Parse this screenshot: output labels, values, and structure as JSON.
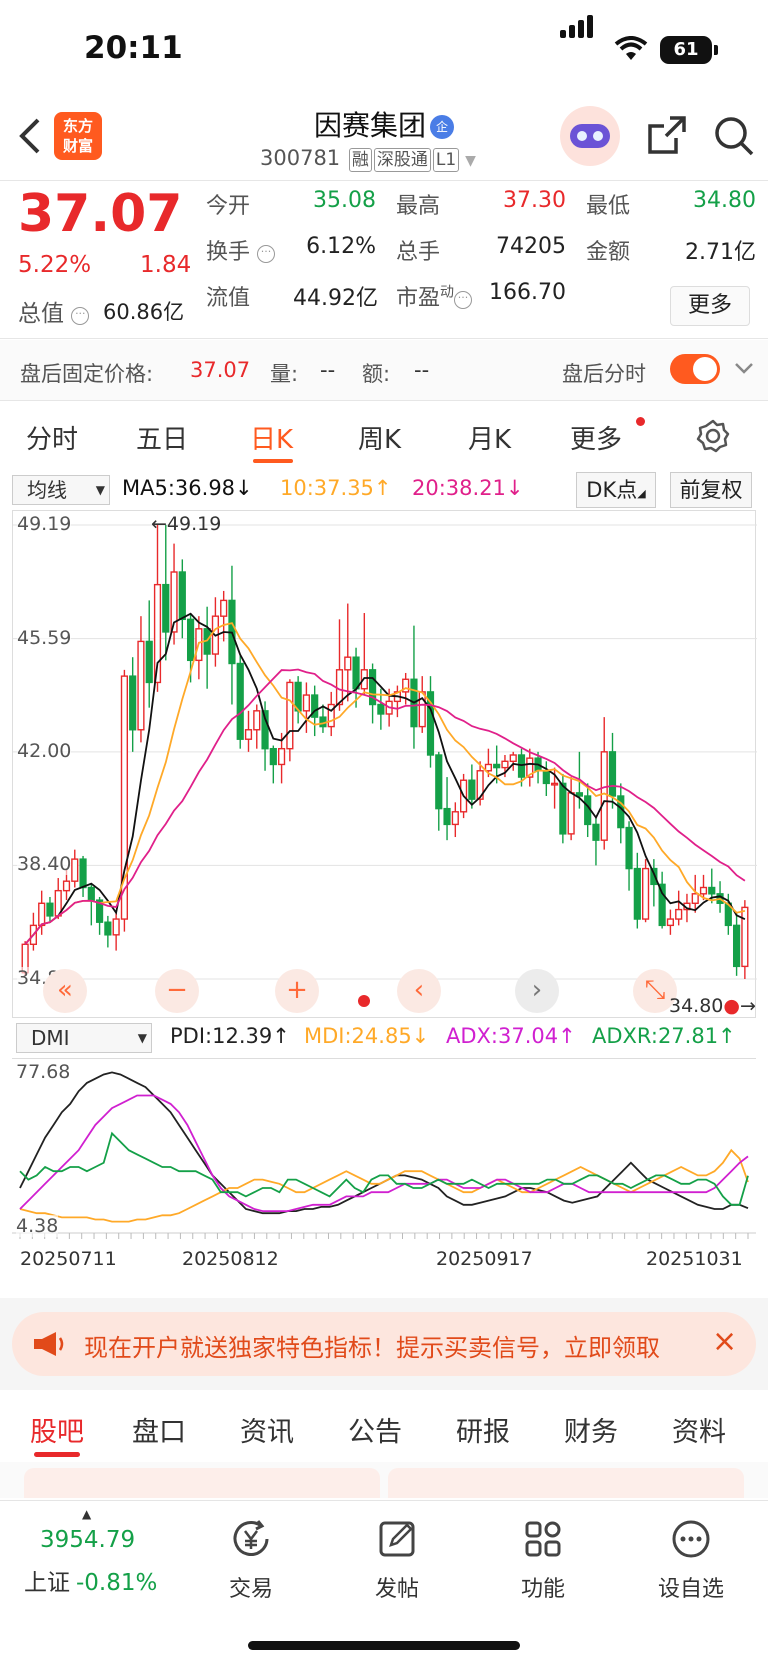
{
  "status": {
    "time": "20:11",
    "battery": "61"
  },
  "header": {
    "logo": [
      "东方",
      "财富"
    ],
    "name": "因赛集团",
    "name_badge": "企",
    "code": "300781",
    "tags": [
      "融",
      "深股通",
      "L1"
    ]
  },
  "quote": {
    "price": "37.07",
    "pct": "5.22%",
    "change": "1.84",
    "total_value_label": "总值",
    "total_value": "60.86亿",
    "open_label": "今开",
    "open": "35.08",
    "high_label": "最高",
    "high": "37.30",
    "low_label": "最低",
    "low": "34.80",
    "turnover_label": "换手",
    "turnover": "6.12%",
    "volume_label": "总手",
    "volume": "74205",
    "amount_label": "金额",
    "amount": "2.71亿",
    "float_label": "流值",
    "float_value": "44.92亿",
    "pe_label": "市盈",
    "pe_sup": "动",
    "pe": "166.70",
    "more": "更多"
  },
  "after_hours": {
    "label": "盘后固定价格:",
    "price": "37.07",
    "vol_label": "量:",
    "vol": "--",
    "amt_label": "额:",
    "amt": "--",
    "switch_label": "盘后分时"
  },
  "kline_tabs": [
    "分时",
    "五日",
    "日K",
    "周K",
    "月K",
    "更多"
  ],
  "ma_bar": {
    "select": "均线",
    "ma5": "MA5:36.98↓",
    "ma10": "10:37.35↑",
    "ma20": "20:38.21↓",
    "dk": "DK点",
    "adjust": "前复权"
  },
  "colors": {
    "up": "#e8292b",
    "down": "#14a048",
    "ma5": "#111111",
    "ma10": "#ffa928",
    "ma20": "#e0208a",
    "accent": "#ff5a1f"
  },
  "chart_data": [
    {
      "type": "candlestick",
      "title": "",
      "y_ticks": [
        "49.19",
        "45.59",
        "42.00",
        "38.40",
        "34.80"
      ],
      "ylim": [
        34.8,
        49.19
      ],
      "high_marker": "←49.19",
      "low_marker": "34.80",
      "candles": [
        [
          35.0,
          35.9,
          34.9,
          36.0
        ],
        [
          35.9,
          36.5,
          35.7,
          36.9
        ],
        [
          36.5,
          37.2,
          36.2,
          37.6
        ],
        [
          37.2,
          36.8,
          36.6,
          37.4
        ],
        [
          36.8,
          37.6,
          36.7,
          38.0
        ],
        [
          37.6,
          37.9,
          37.3,
          38.3
        ],
        [
          37.9,
          38.6,
          37.7,
          38.9
        ],
        [
          38.6,
          37.7,
          37.4,
          38.7
        ],
        [
          37.7,
          37.3,
          36.5,
          37.8
        ],
        [
          37.3,
          36.6,
          36.2,
          37.4
        ],
        [
          36.6,
          36.2,
          35.8,
          36.8
        ],
        [
          36.2,
          36.7,
          35.7,
          36.9
        ],
        [
          36.7,
          44.4,
          36.3,
          44.6
        ],
        [
          44.4,
          42.7,
          42.0,
          45.0
        ],
        [
          42.7,
          45.5,
          42.3,
          46.3
        ],
        [
          45.5,
          44.2,
          43.4,
          46.8
        ],
        [
          44.2,
          47.3,
          43.9,
          49.19
        ],
        [
          47.3,
          45.8,
          44.9,
          49.19
        ],
        [
          45.8,
          47.7,
          45.4,
          48.6
        ],
        [
          47.7,
          46.2,
          45.6,
          48.1
        ],
        [
          46.2,
          44.9,
          44.2,
          46.4
        ],
        [
          44.9,
          45.9,
          44.3,
          46.3
        ],
        [
          45.9,
          45.1,
          44.0,
          46.6
        ],
        [
          45.1,
          46.3,
          44.7,
          46.9
        ],
        [
          46.3,
          46.8,
          45.5,
          47.1
        ],
        [
          46.8,
          44.8,
          43.5,
          47.9
        ],
        [
          44.8,
          42.4,
          42.1,
          45.1
        ],
        [
          42.4,
          42.7,
          42.0,
          43.3
        ],
        [
          42.7,
          43.3,
          42.1,
          43.5
        ],
        [
          43.3,
          42.1,
          41.4,
          43.6
        ],
        [
          42.1,
          41.6,
          41.0,
          42.2
        ],
        [
          41.6,
          42.1,
          41.0,
          42.6
        ],
        [
          42.1,
          44.2,
          41.7,
          44.3
        ],
        [
          44.2,
          43.3,
          42.9,
          44.4
        ],
        [
          43.3,
          43.8,
          42.6,
          44.2
        ],
        [
          43.8,
          43.1,
          42.5,
          44.1
        ],
        [
          43.1,
          42.8,
          42.6,
          43.5
        ],
        [
          42.8,
          43.5,
          42.5,
          43.9
        ],
        [
          43.5,
          44.6,
          43.3,
          46.2
        ],
        [
          44.6,
          45.0,
          43.6,
          46.7
        ],
        [
          45.0,
          44.0,
          43.4,
          45.3
        ],
        [
          44.0,
          44.6,
          43.8,
          46.4
        ],
        [
          44.6,
          43.5,
          42.9,
          44.8
        ],
        [
          43.5,
          43.2,
          42.7,
          44.0
        ],
        [
          43.2,
          43.6,
          42.8,
          44.0
        ],
        [
          43.6,
          43.9,
          43.1,
          44.1
        ],
        [
          43.9,
          44.3,
          43.5,
          44.5
        ],
        [
          44.3,
          42.8,
          42.1,
          46.0
        ],
        [
          42.8,
          43.9,
          42.6,
          44.4
        ],
        [
          43.9,
          41.9,
          41.5,
          44.4
        ],
        [
          41.9,
          40.2,
          39.5,
          42.0
        ],
        [
          40.2,
          39.7,
          39.2,
          41.2
        ],
        [
          39.7,
          40.1,
          39.3,
          40.4
        ],
        [
          40.1,
          41.1,
          39.9,
          41.3
        ],
        [
          41.1,
          40.5,
          40.2,
          41.6
        ],
        [
          40.5,
          41.4,
          40.3,
          41.7
        ],
        [
          41.4,
          41.6,
          41.2,
          42.1
        ],
        [
          41.6,
          41.5,
          41.0,
          42.2
        ],
        [
          41.5,
          41.7,
          41.2,
          41.9
        ],
        [
          41.7,
          41.9,
          41.4,
          42.0
        ],
        [
          41.9,
          41.2,
          40.9,
          42.1
        ],
        [
          41.2,
          41.8,
          40.9,
          42.1
        ],
        [
          41.8,
          41.4,
          41.0,
          42.0
        ],
        [
          41.4,
          41.0,
          40.6,
          41.7
        ],
        [
          41.0,
          41.0,
          40.2,
          41.5
        ],
        [
          41.0,
          39.4,
          39.1,
          41.3
        ],
        [
          39.4,
          40.7,
          39.2,
          41.2
        ],
        [
          40.7,
          40.6,
          40.2,
          42.0
        ],
        [
          40.6,
          39.7,
          39.3,
          41.0
        ],
        [
          39.7,
          39.2,
          38.4,
          39.9
        ],
        [
          39.2,
          42.0,
          38.9,
          43.1
        ],
        [
          42.0,
          40.6,
          40.2,
          42.6
        ],
        [
          40.6,
          39.6,
          39.1,
          41.0
        ],
        [
          39.6,
          38.3,
          37.6,
          39.8
        ],
        [
          38.3,
          36.7,
          36.4,
          38.8
        ],
        [
          36.7,
          38.3,
          36.6,
          38.6
        ],
        [
          38.3,
          37.8,
          37.1,
          38.6
        ],
        [
          37.8,
          36.5,
          36.4,
          38.2
        ],
        [
          36.5,
          36.7,
          36.2,
          37.0
        ],
        [
          36.7,
          37.0,
          36.5,
          37.6
        ],
        [
          37.0,
          37.2,
          36.6,
          37.5
        ],
        [
          37.2,
          37.5,
          36.9,
          38.1
        ],
        [
          37.5,
          37.7,
          37.3,
          38.1
        ],
        [
          37.7,
          37.5,
          37.2,
          38.3
        ],
        [
          37.5,
          37.2,
          36.9,
          37.9
        ],
        [
          37.2,
          36.5,
          36.2,
          37.5
        ],
        [
          36.5,
          35.2,
          34.9,
          36.9
        ],
        [
          35.2,
          37.07,
          34.8,
          37.3
        ]
      ]
    },
    {
      "type": "line",
      "title": "",
      "indicator": "DMI",
      "y_ticks": [
        "77.68",
        "4.38"
      ],
      "ylim": [
        4.38,
        77.68
      ],
      "x_ticks": [
        "20250711",
        "20250812",
        "20250917",
        "20251031"
      ],
      "series": [
        {
          "name": "PDI:12.39↑",
          "values": [
            22,
            30,
            38,
            46,
            52,
            58,
            62,
            68,
            72,
            74,
            76,
            77,
            76,
            74,
            72,
            70,
            66,
            62,
            58,
            52,
            46,
            40,
            34,
            28,
            24,
            20,
            16,
            12,
            11,
            10,
            10,
            10,
            11,
            11,
            12,
            12,
            13,
            13,
            14,
            16,
            18,
            20,
            22,
            24,
            26,
            28,
            28,
            27,
            26,
            24,
            22,
            18,
            16,
            14,
            14,
            15,
            16,
            17,
            18,
            20,
            22,
            22,
            21,
            20,
            18,
            16,
            15,
            16,
            17,
            18,
            22,
            26,
            30,
            34,
            30,
            26,
            24,
            22,
            20,
            18,
            16,
            14,
            13,
            12,
            12,
            14,
            14,
            12.39
          ]
        },
        {
          "name": "MDI:24.85↓",
          "values": [
            12,
            11,
            10,
            10,
            9,
            8,
            8,
            8,
            8,
            7,
            7,
            6,
            6,
            6,
            7,
            7,
            8,
            9,
            9,
            10,
            12,
            14,
            16,
            18,
            20,
            22,
            22,
            24,
            26,
            26,
            25,
            24,
            22,
            20,
            20,
            22,
            24,
            26,
            28,
            30,
            28,
            26,
            24,
            24,
            26,
            28,
            30,
            30,
            30,
            28,
            26,
            24,
            22,
            20,
            20,
            22,
            24,
            26,
            24,
            22,
            20,
            20,
            22,
            24,
            26,
            28,
            30,
            32,
            30,
            28,
            26,
            24,
            22,
            20,
            22,
            24,
            26,
            28,
            30,
            32,
            30,
            28,
            28,
            30,
            34,
            40,
            36,
            24.85
          ]
        },
        {
          "name": "ADX:37.04↑",
          "values": [
            12,
            16,
            20,
            24,
            28,
            32,
            36,
            40,
            46,
            52,
            56,
            60,
            62,
            64,
            66,
            66,
            66,
            64,
            62,
            58,
            52,
            44,
            36,
            28,
            22,
            18,
            16,
            14,
            12,
            11,
            11,
            11,
            11,
            12,
            13,
            14,
            14,
            14,
            16,
            18,
            18,
            18,
            20,
            20,
            20,
            22,
            24,
            24,
            24,
            24,
            26,
            26,
            24,
            22,
            22,
            22,
            24,
            26,
            26,
            24,
            22,
            20,
            20,
            20,
            22,
            24,
            24,
            22,
            20,
            20,
            20,
            20,
            20,
            20,
            20,
            20,
            20,
            20,
            20,
            20,
            20,
            20,
            20,
            22,
            26,
            30,
            34,
            37.04
          ]
        },
        {
          "name": "ADXR:27.81↑",
          "values": [
            30,
            26,
            28,
            32,
            30,
            30,
            32,
            32,
            30,
            32,
            34,
            48,
            44,
            40,
            38,
            36,
            34,
            32,
            32,
            30,
            30,
            30,
            28,
            26,
            20,
            20,
            20,
            18,
            20,
            22,
            22,
            20,
            26,
            26,
            24,
            22,
            20,
            18,
            22,
            26,
            22,
            20,
            26,
            28,
            28,
            24,
            24,
            22,
            22,
            24,
            26,
            24,
            24,
            24,
            26,
            24,
            22,
            24,
            24,
            24,
            24,
            24,
            24,
            26,
            26,
            24,
            24,
            26,
            28,
            28,
            26,
            24,
            24,
            22,
            24,
            26,
            28,
            28,
            26,
            24,
            24,
            26,
            26,
            24,
            18,
            14,
            14,
            27.81
          ]
        }
      ]
    }
  ],
  "dmi_bar": {
    "select": "DMI"
  },
  "banner": {
    "text": "现在开户就送独家特色指标！提示买卖信号，立即领取"
  },
  "bottom_tabs": [
    "股吧",
    "盘口",
    "资讯",
    "公告",
    "研报",
    "财务",
    "资料"
  ],
  "bottom_nav": {
    "index_value": "3954.79",
    "index_name": "上证",
    "index_pct": "-0.81%",
    "items": [
      "交易",
      "发帖",
      "功能",
      "设自选"
    ]
  }
}
